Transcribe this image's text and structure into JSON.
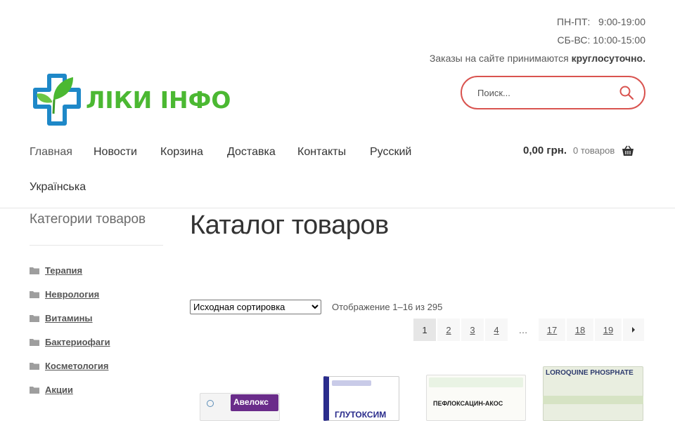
{
  "header": {
    "hours_weekdays": "ПН-ПТ:   9:00-19:00",
    "hours_weekend": "СБ-ВС: 10:00-15:00",
    "orders_text": "Заказы на сайте принимаются",
    "orders_emphasis": "круглосуточно."
  },
  "logo": {
    "text": "ЛІКИ ІНФО",
    "brand_color": "#4bb832",
    "accent_color": "#1e88c8"
  },
  "search": {
    "placeholder": "Поиск...",
    "accent_color": "#d9534f",
    "icon": "search-icon"
  },
  "nav": {
    "items": [
      {
        "label": "Главная"
      },
      {
        "label": "Новости"
      },
      {
        "label": "Корзина"
      },
      {
        "label": "Доставка"
      },
      {
        "label": "Контакты"
      },
      {
        "label": "Русский"
      },
      {
        "label": "Українська"
      }
    ]
  },
  "cart": {
    "amount": "0,00 грн.",
    "count": "0 товаров",
    "icon": "basket-icon"
  },
  "sidebar": {
    "title": "Категории товаров",
    "categories": [
      {
        "label": "Терапия"
      },
      {
        "label": "Неврология"
      },
      {
        "label": "Витамины"
      },
      {
        "label": "Бактериофаги"
      },
      {
        "label": "Косметология"
      },
      {
        "label": "Акции"
      }
    ]
  },
  "main": {
    "title": "Каталог товаров",
    "sort_selected": "Исходная сортировка",
    "result_count": "Отображение 1–16 из 295"
  },
  "pagination": {
    "pages": [
      "1",
      "2",
      "3",
      "4",
      "…",
      "17",
      "18",
      "19"
    ],
    "current": "1",
    "next_icon": "arrow-right-icon"
  },
  "products": [
    {
      "label": "Авелокс"
    },
    {
      "label": "ГЛУТОКСИМ"
    },
    {
      "label": "ПЕФЛОКСАЦИН-АКОС"
    },
    {
      "label": "LOROQUINE PHOSPHATE"
    }
  ]
}
